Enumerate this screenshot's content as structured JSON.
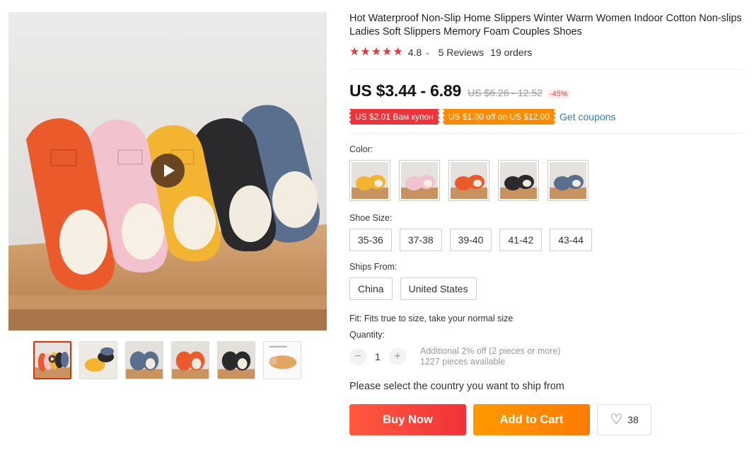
{
  "product": {
    "title": "Hot Waterproof Non-Slip Home Slippers Winter Warm Women Indoor Cotton Non-slips Ladies Soft Slippers Memory Foam Couples Shoes",
    "rating": "4.8",
    "rating_stars": 5,
    "reviews": "5 Reviews",
    "orders": "19 orders"
  },
  "price": {
    "current": "US $3.44 - 6.89",
    "original": "US $6.26 - 12.52",
    "discount": "-45%"
  },
  "coupons": {
    "red": "US $2.01 Вам купон",
    "orange": "US $1.00 off on US $12.00",
    "get_coupons": "Get coupons"
  },
  "color": {
    "label": "Color:",
    "swatches": [
      "yellow",
      "pink",
      "orange",
      "black",
      "blue-gray"
    ]
  },
  "size": {
    "label": "Shoe Size:",
    "options": [
      "35-36",
      "37-38",
      "39-40",
      "41-42",
      "43-44"
    ]
  },
  "ships_from": {
    "label": "Ships From:",
    "options": [
      "China",
      "United States"
    ]
  },
  "fit": "Fit: Fits true to size, take your normal size",
  "quantity": {
    "label": "Quantity:",
    "minus": "−",
    "value": "1",
    "plus": "+",
    "additional": "Additional 2% off (2 pieces or more)",
    "available": "1227 pieces available"
  },
  "ship_prompt": "Please select the country you want to ship from",
  "actions": {
    "buy_now": "Buy Now",
    "add_to_cart": "Add to Cart",
    "wishlist_count": "38"
  },
  "colors": {
    "accent_red": "#f0323a",
    "accent_orange": "#ff8a00",
    "link_blue": "#2e7cc4"
  }
}
